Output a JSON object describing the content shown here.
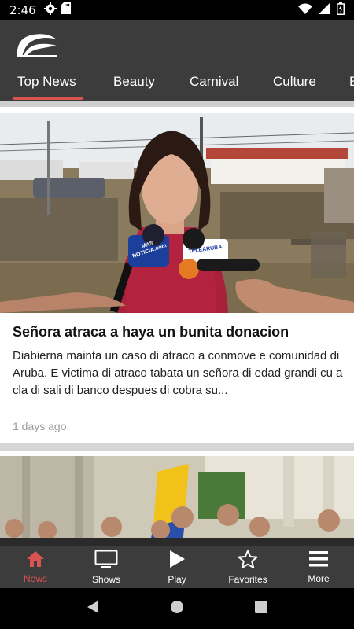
{
  "status_bar": {
    "time": "2:46",
    "icons": [
      "gear-icon",
      "sd-card-icon",
      "wifi-icon",
      "signal-icon",
      "battery-icon"
    ]
  },
  "app_bar": {
    "logo": "app-logo",
    "tabs": [
      {
        "label": "Top News",
        "active": true
      },
      {
        "label": "Beauty",
        "active": false
      },
      {
        "label": "Carnival",
        "active": false
      },
      {
        "label": "Culture",
        "active": false
      },
      {
        "label": "E",
        "active": false
      }
    ]
  },
  "articles": [
    {
      "title": "Señora atraca a haya un bunita donacion",
      "description": "Diabierna mainta un caso di atraco a conmove e comunidad di Aruba. E victima di atraco tabata un señora di edad grandi cu a cla di sali di banco despues di cobra su...",
      "time": "1 days ago",
      "mic_labels": [
        "MAS NOTICIA.com",
        "TELEARUBA"
      ]
    },
    {
      "title": "",
      "description": "",
      "time": ""
    }
  ],
  "bottom_nav": [
    {
      "label": "News",
      "icon": "home-icon",
      "active": true
    },
    {
      "label": "Shows",
      "icon": "tv-icon",
      "active": false
    },
    {
      "label": "Play",
      "icon": "play-icon",
      "active": false
    },
    {
      "label": "Favorites",
      "icon": "star-icon",
      "active": false
    },
    {
      "label": "More",
      "icon": "menu-icon",
      "active": false
    }
  ],
  "colors": {
    "app_bar": "#3c3c3c",
    "accent": "#d9534f",
    "status_bar": "#000000"
  }
}
